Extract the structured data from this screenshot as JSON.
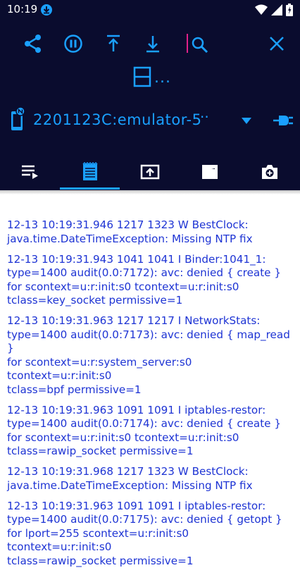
{
  "status_bar": {
    "time": "10:19"
  },
  "device": {
    "name": "2201123C:emulator-5"
  },
  "more_actions": "...",
  "log": [
    "12-13 10:19:31.946  1217  1323 W BestClock:\njava.time.DateTimeException: Missing NTP fix",
    "12-13 10:19:31.943  1041  1041 I Binder:1041_1:\ntype=1400 audit(0.0:7172): avc: denied { create }\nfor scontext=u:r:init:s0 tcontext=u:r:init:s0\ntclass=key_socket permissive=1",
    "12-13 10:19:31.963  1217  1217 I NetworkStats:\ntype=1400 audit(0.0:7173): avc: denied { map_read }\nfor scontext=u:r:system_server:s0 tcontext=u:r:init:s0\ntclass=bpf permissive=1",
    "12-13 10:19:31.963  1091  1091 I iptables-restor:\ntype=1400 audit(0.0:7174): avc: denied { create }\nfor scontext=u:r:init:s0 tcontext=u:r:init:s0\ntclass=rawip_socket permissive=1",
    "12-13 10:19:31.968  1217  1323 W BestClock:\njava.time.DateTimeException: Missing NTP fix",
    "12-13 10:19:31.963  1091  1091 I iptables-restor:\ntype=1400 audit(0.0:7175): avc: denied { getopt }\nfor lport=255 scontext=u:r:init:s0 tcontext=u:r:init:s0\ntclass=rawip_socket permissive=1"
  ],
  "colors": {
    "bar_bg": "#0a0c2e",
    "accent": "#1aa0ff",
    "log_text": "#1e34d4",
    "cursor": "#e0218a"
  }
}
